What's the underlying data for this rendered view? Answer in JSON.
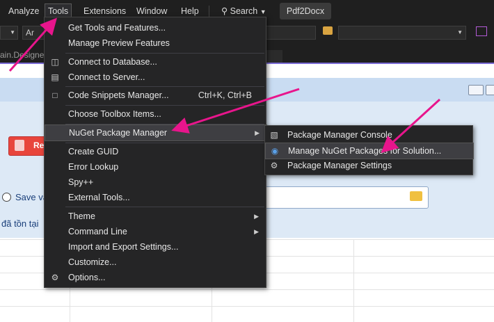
{
  "menubar": {
    "items": [
      "Analyze",
      "Tools",
      "Extensions",
      "Window",
      "Help"
    ],
    "search_label": "Search",
    "project": "Pdf2Docx"
  },
  "toolbar": {
    "font_box": "Ar"
  },
  "tab": {
    "label": "ain.Designer"
  },
  "designer": {
    "button_partial": "Re",
    "radio_label": "Save va",
    "status_text": "đã tồn tại"
  },
  "tools_menu": {
    "items": [
      {
        "label": "Get Tools and Features...",
        "icon": "",
        "shortcut": ""
      },
      {
        "label": "Manage Preview Features",
        "icon": "",
        "shortcut": ""
      },
      {
        "label": "Connect to Database...",
        "icon": "database-connect-icon",
        "shortcut": ""
      },
      {
        "label": "Connect to Server...",
        "icon": "server-connect-icon",
        "shortcut": ""
      },
      {
        "label": "Code Snippets Manager...",
        "icon": "snippet-icon",
        "shortcut": "Ctrl+K, Ctrl+B"
      },
      {
        "label": "Choose Toolbox Items...",
        "icon": "",
        "shortcut": ""
      },
      {
        "label": "NuGet Package Manager",
        "icon": "",
        "shortcut": "",
        "submenu": true
      },
      {
        "label": "Create GUID",
        "icon": "",
        "shortcut": ""
      },
      {
        "label": "Error Lookup",
        "icon": "",
        "shortcut": ""
      },
      {
        "label": "Spy++",
        "icon": "",
        "shortcut": ""
      },
      {
        "label": "External Tools...",
        "icon": "",
        "shortcut": ""
      },
      {
        "label": "Theme",
        "icon": "",
        "shortcut": "",
        "submenu": true
      },
      {
        "label": "Command Line",
        "icon": "",
        "shortcut": "",
        "submenu": true
      },
      {
        "label": "Import and Export Settings...",
        "icon": "",
        "shortcut": ""
      },
      {
        "label": "Customize...",
        "icon": "",
        "shortcut": ""
      },
      {
        "label": "Options...",
        "icon": "gear-icon",
        "shortcut": ""
      }
    ]
  },
  "nuget_submenu": {
    "items": [
      {
        "label": "Package Manager Console",
        "icon": "console-icon"
      },
      {
        "label": "Manage NuGet Packages for Solution...",
        "icon": "nuget-icon"
      },
      {
        "label": "Package Manager Settings",
        "icon": "gear-icon"
      }
    ]
  },
  "colors": {
    "annotation_arrow": "#e8158c",
    "accent": "#7b6cd6"
  }
}
